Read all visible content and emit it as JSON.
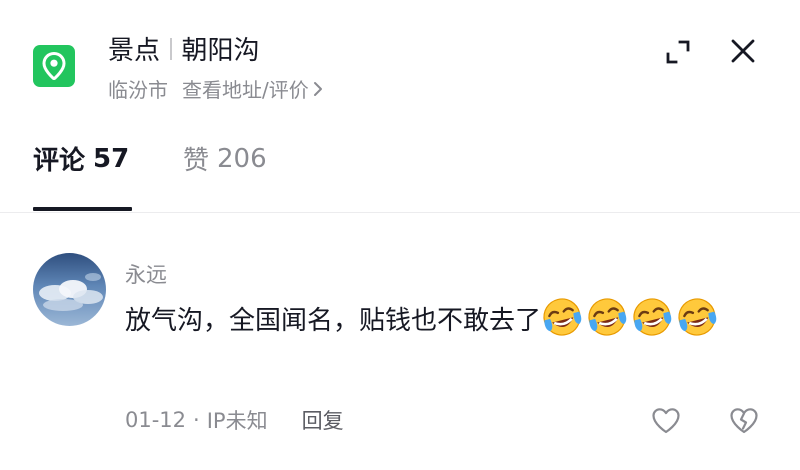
{
  "header": {
    "category": "景点",
    "place_name": "朝阳沟",
    "city": "临汾市",
    "address_link": "查看地址/评价",
    "icons": {
      "location": "location-pin-icon",
      "expand": "expand-icon",
      "close": "close-icon",
      "chevron": "chevron-right-icon"
    }
  },
  "tabs": [
    {
      "label": "评论",
      "count": "57",
      "active": true
    },
    {
      "label": "赞",
      "count": "206",
      "active": false
    }
  ],
  "comment": {
    "username": "永远",
    "text": "放气沟，全国闻名，贴钱也不敢去了",
    "emojis": [
      "laughing-crying-emoji",
      "laughing-crying-emoji",
      "laughing-crying-emoji",
      "laughing-crying-emoji"
    ],
    "date": "01-12",
    "separator": "·",
    "location": "IP未知",
    "reply_label": "回复",
    "icons": {
      "like": "heart-outline-icon",
      "dislike": "broken-heart-icon"
    }
  },
  "colors": {
    "accent_green": "#22c55e",
    "primary_text": "#161823",
    "secondary_text": "#8a8b91"
  }
}
